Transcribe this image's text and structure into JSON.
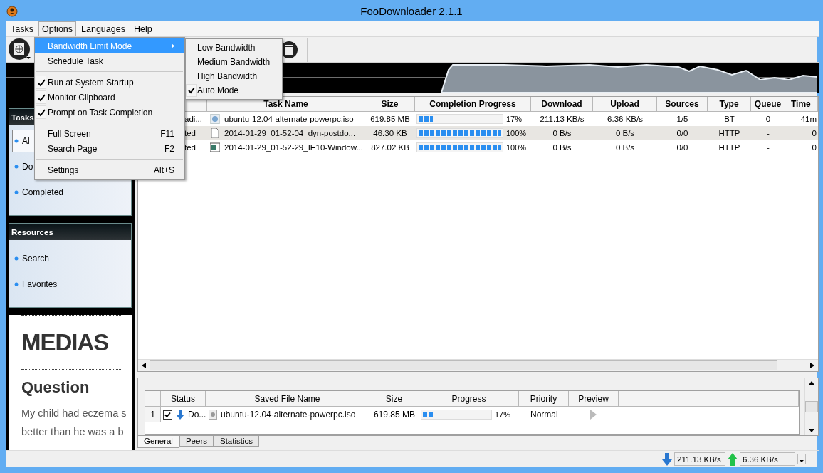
{
  "window": {
    "title": "FooDownloader 2.1.1"
  },
  "menu_bar": [
    {
      "label": "Tasks",
      "selected": false
    },
    {
      "label": "Options",
      "selected": true
    },
    {
      "label": "Languages",
      "selected": false
    },
    {
      "label": "Help",
      "selected": false
    }
  ],
  "options_menu": {
    "items": [
      {
        "kind": "submenu",
        "label": "Bandwidth Limit Mode",
        "selected": true
      },
      {
        "kind": "item",
        "label": "Schedule Task",
        "selected": false
      },
      {
        "kind": "separator"
      },
      {
        "kind": "check",
        "label": "Run at System Startup",
        "checked": true,
        "selected": false
      },
      {
        "kind": "check",
        "label": "Monitor Clipboard",
        "checked": true,
        "selected": false
      },
      {
        "kind": "check",
        "label": "Prompt on Task Completion",
        "checked": true,
        "selected": false
      },
      {
        "kind": "separator"
      },
      {
        "kind": "item",
        "label": "Full Screen",
        "shortcut": "F11",
        "selected": false
      },
      {
        "kind": "item",
        "label": "Search Page",
        "shortcut": "F2",
        "selected": false
      },
      {
        "kind": "separator"
      },
      {
        "kind": "item",
        "label": "Settings",
        "shortcut": "Alt+S",
        "selected": false
      }
    ]
  },
  "bandwidth_submenu": {
    "items": [
      {
        "label": "Low Bandwidth",
        "checked": false
      },
      {
        "label": "Medium Bandwidth",
        "checked": false
      },
      {
        "label": "High Bandwidth",
        "checked": false
      },
      {
        "label": "Auto Mode",
        "checked": true
      }
    ]
  },
  "sidebar": {
    "panels": [
      {
        "title": "Tasks",
        "items": [
          {
            "label": "Al",
            "selected": true
          },
          {
            "label": "Do",
            "selected": false
          },
          {
            "label": "Completed",
            "selected": false
          }
        ]
      },
      {
        "title": "Resources",
        "items": [
          {
            "label": "Search",
            "selected": false
          },
          {
            "label": "Favorites",
            "selected": false
          }
        ]
      }
    ]
  },
  "web_preview": {
    "logo": "MEDIAS",
    "heading": "Question",
    "lines": [
      "My child had eczema s",
      "better than he was a b"
    ]
  },
  "task_table": {
    "columns": [
      "Task Name",
      "Size",
      "Completion Progress",
      "Download",
      "Upload",
      "Sources",
      "Type",
      "Queue",
      "Time"
    ],
    "rows": [
      {
        "status": "adi...",
        "kind": "disc",
        "name": "ubuntu-12.04-alternate-powerpc.iso",
        "size": "619.85 MB",
        "level": 0.17,
        "percent": "17%",
        "download": "211.13 KB/s",
        "upload": "6.36 KB/s",
        "sources": "1/5",
        "type": "BT",
        "queue": "0",
        "time": "41m",
        "selected": false
      },
      {
        "status": "ted",
        "kind": "document",
        "name": "2014-01-29_01-52-04_dyn-postdo...",
        "size": "46.30 KB",
        "level": 1,
        "percent": "100%",
        "download": "0 B/s",
        "upload": "0 B/s",
        "sources": "0/0",
        "type": "HTTP",
        "queue": "-",
        "time": "0",
        "selected": true
      },
      {
        "status": "ted",
        "kind": "image",
        "name": "2014-01-29_01-52-29_IE10-Window...",
        "size": "827.02 KB",
        "level": 1,
        "percent": "100%",
        "download": "0 B/s",
        "upload": "0 B/s",
        "sources": "0/0",
        "type": "HTTP",
        "queue": "-",
        "time": "0",
        "selected": false
      }
    ]
  },
  "detail_table": {
    "columns": [
      "Status",
      "Saved File Name",
      "Size",
      "Progress",
      "Priority",
      "Preview"
    ],
    "rows": [
      {
        "index": "1",
        "checked": true,
        "status": "Do...",
        "name": "ubuntu-12.04-alternate-powerpc.iso",
        "size": "619.85 MB",
        "level": 0.17,
        "percent": "17%",
        "priority": "Normal"
      }
    ]
  },
  "detail_tabs": [
    {
      "label": "General",
      "selected": true
    },
    {
      "label": "Peers",
      "selected": false
    },
    {
      "label": "Statistics",
      "selected": false
    }
  ],
  "status_bar": {
    "download": "211.13 KB/s",
    "upload": "6.36 KB/s"
  }
}
